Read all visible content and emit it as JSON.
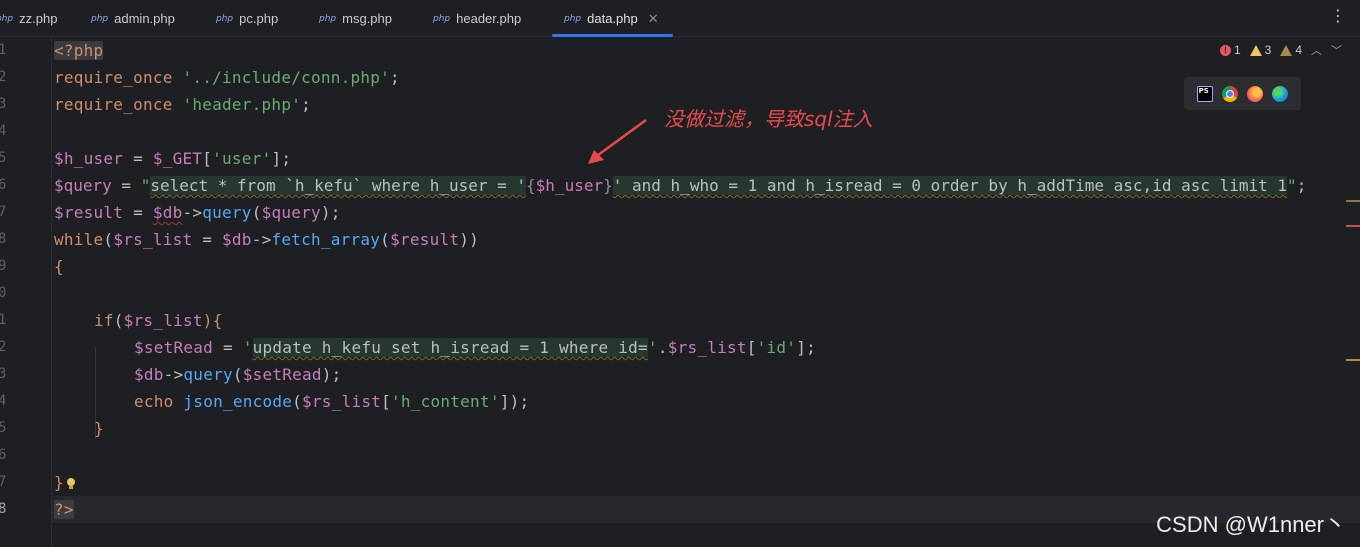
{
  "tabs": [
    {
      "badge": "php",
      "label": "zz.php"
    },
    {
      "badge": "php",
      "label": "admin.php"
    },
    {
      "badge": "php",
      "label": "pc.php"
    },
    {
      "badge": "php",
      "label": "msg.php"
    },
    {
      "badge": "php",
      "label": "header.php"
    },
    {
      "badge": "php",
      "label": "data.php",
      "active": true
    }
  ],
  "tab_close_glyph": "✕",
  "tab_menu_glyph": "⋮",
  "inspections": {
    "errors": "1",
    "warnings": "3",
    "weak_warnings": "4",
    "error_glyph": "!",
    "up_glyph": "︿",
    "down_glyph": "﹀"
  },
  "gutter": {
    "line_numbers": [
      "1",
      "2",
      "3",
      "4",
      "5",
      "6",
      "7",
      "8",
      "9",
      "0",
      "1",
      "2",
      "3",
      "4",
      "5",
      "6",
      "7",
      "8"
    ]
  },
  "code": {
    "l1": "<?php",
    "l2_kw": "require_once",
    "l2_str": "'../include/conn.php'",
    "l2_end": ";",
    "l3_kw": "require_once",
    "l3_str": "'header.php'",
    "l3_end": ";",
    "l5_var": "$h_user",
    "l5_eq": " = ",
    "l5_get": "$_GET",
    "l5_br1": "[",
    "l5_key": "'user'",
    "l5_br2": "];",
    "l6_var": "$query",
    "l6_eq": " = ",
    "l6_q1": "\"",
    "l6_sql1": "select * from `h_kefu` where h_user = '",
    "l6_brace1": "{",
    "l6_inner": "$h_user",
    "l6_brace2": "}",
    "l6_sql2": "' and h_who = 1 and h_isread = 0 order by h_addTime asc,id asc limit 1",
    "l6_q2": "\"",
    "l6_end": ";",
    "l7_var": "$result",
    "l7_eq": " = ",
    "l7_db": "$db",
    "l7_arrow": "->",
    "l7_fn": "query",
    "l7_p1": "(",
    "l7_arg": "$query",
    "l7_p2": ");",
    "l8_kw": "while",
    "l8_p1": "(",
    "l8_var": "$rs_list",
    "l8_eq": " = ",
    "l8_db": "$db",
    "l8_arrow": "->",
    "l8_fn": "fetch_array",
    "l8_p2": "(",
    "l8_arg": "$result",
    "l8_p3": "))",
    "l9": "{",
    "l11_kw": "if",
    "l11_p1": "(",
    "l11_var": "$rs_list",
    "l11_p2": "){",
    "l12_var": "$setRead",
    "l12_eq": " = ",
    "l12_q": "'",
    "l12_sql": "update h_kefu set h_isread = 1 where id=",
    "l12_q2": "'",
    "l12_dot": ".",
    "l12_var2": "$rs_list",
    "l12_br1": "[",
    "l12_key": "'id'",
    "l12_br2": "];",
    "l13_db": "$db",
    "l13_arrow": "->",
    "l13_fn": "query",
    "l13_p1": "(",
    "l13_arg": "$setRead",
    "l13_p2": ");",
    "l14_kw": "echo",
    "l14_fn": "json_encode",
    "l14_p1": "(",
    "l14_var": "$rs_list",
    "l14_br1": "[",
    "l14_key": "'h_content'",
    "l14_br2": "]);",
    "l15": "}",
    "l17": "}",
    "l18": "?>"
  },
  "annotation": "没做过滤，导致sql注入",
  "browser_icons": [
    "phpstorm-icon",
    "chrome-icon",
    "firefox-icon",
    "edge-icon"
  ],
  "ps_label": "PS",
  "watermark": "CSDN @W1nner丶",
  "colors": {
    "accent": "#3574f0",
    "annotation": "#e84a4a",
    "error": "#e55765",
    "warning": "#f2c55c"
  }
}
